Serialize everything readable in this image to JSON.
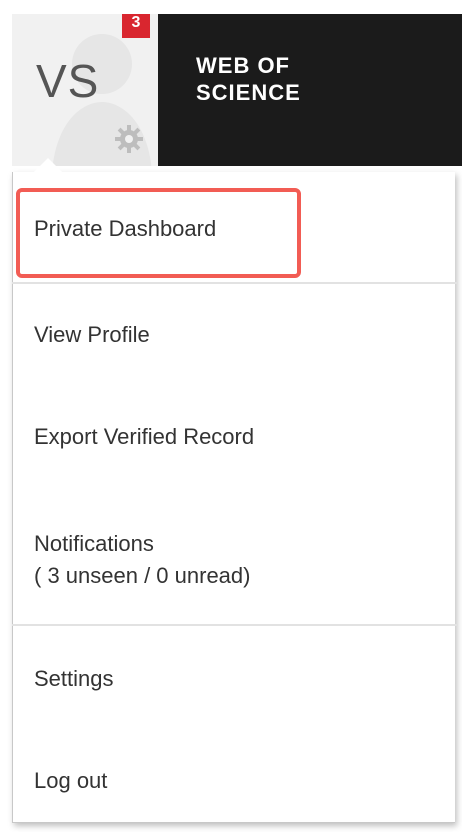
{
  "header": {
    "avatar_initials": "VS",
    "notification_count": "3",
    "brand_line1": "WEB OF",
    "brand_line2": "SCIENCE",
    "settings_icon": "gear-icon"
  },
  "menu": {
    "items": [
      {
        "label": "Private Dashboard"
      },
      {
        "label": "View Profile"
      },
      {
        "label": "Export Verified Record"
      },
      {
        "label": "Notifications",
        "sublabel": "( 3 unseen / 0 unread)"
      },
      {
        "label": "Settings"
      },
      {
        "label": "Log out"
      }
    ],
    "highlighted_index": 0
  },
  "colors": {
    "header_bg": "#1b1b1b",
    "badge": "#d9262f",
    "highlight": "#f25c54"
  }
}
